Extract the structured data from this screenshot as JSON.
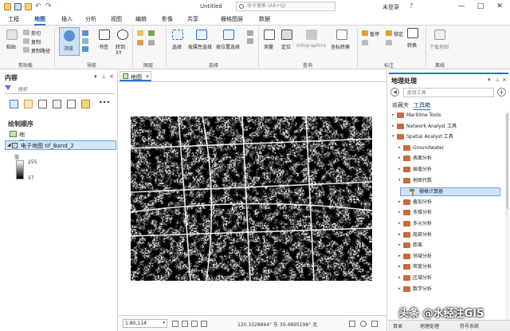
{
  "titlebar": {
    "title": "Untitled",
    "search_placeholder": "命令搜索 (Alt+Q)",
    "login": "未登录",
    "help": "?",
    "minimize": "—",
    "maximize": "□",
    "close": "✕"
  },
  "ribbon_tabs": [
    "工程",
    "地图",
    "插入",
    "分析",
    "视图",
    "编辑",
    "影像",
    "共享",
    "栅格图层",
    "数据"
  ],
  "ribbon_active_tab": "地图",
  "ribbon": {
    "clipboard": {
      "paste": "粘贴",
      "cut": "剪切",
      "copy": "复制",
      "copy_path": "复制路径",
      "group": "剪贴板"
    },
    "navigate": {
      "explore": "浏览",
      "bookmarks": "书签",
      "goto": "转到 XY",
      "group": "导航"
    },
    "layer": {
      "group": "图层"
    },
    "selection": {
      "select": "选择",
      "by_attr": "按属性选择",
      "by_loc": "按位置选择",
      "group": "选择"
    },
    "inquiry": {
      "measure": "测量",
      "locate": "定位",
      "infographics": "Infographics",
      "coord_convert": "坐标转换",
      "group": "查询"
    },
    "labeling": {
      "pause": "暂停",
      "lock": "锁定",
      "convert": "转换",
      "group": "标注"
    },
    "offline": {
      "download_map": "下载地图",
      "group": "离线"
    }
  },
  "contents": {
    "title": "内容",
    "search_placeholder": "搜索",
    "section": "绘制顺序",
    "map_name": "地图",
    "layer_name": "电子地图 tif_Band_2",
    "layer_checked": "✓",
    "value_label": "值",
    "ramp_high": "255",
    "ramp_low": "57"
  },
  "map_view": {
    "tab_label": "地图",
    "scale": "1:80,114",
    "coordinates": "120.3328864° 东 30.4895198° 北"
  },
  "geoprocessing": {
    "title": "地理处理",
    "search_placeholder": "查找工具",
    "tab_favorites": "收藏夹",
    "tab_toolboxes": "工具箱",
    "tree": [
      {
        "label": "Maritime Tools",
        "level": 0,
        "arrow": "▸",
        "type": "toolbox"
      },
      {
        "label": "Network Analyst 工具",
        "level": 0,
        "arrow": "▸",
        "type": "toolbox"
      },
      {
        "label": "Spatial Analyst 工具",
        "level": 0,
        "arrow": "▾",
        "type": "toolbox"
      },
      {
        "label": "Groundwater",
        "level": 1,
        "arrow": "▸",
        "type": "toolset"
      },
      {
        "label": "表面分析",
        "level": 1,
        "arrow": "▸",
        "type": "toolset"
      },
      {
        "label": "插值分析",
        "level": 1,
        "arrow": "▸",
        "type": "toolset"
      },
      {
        "label": "地图代数",
        "level": 1,
        "arrow": "▾",
        "type": "toolset"
      },
      {
        "label": "栅格计算器",
        "level": 2,
        "arrow": "",
        "type": "tool",
        "selected": true
      },
      {
        "label": "叠加分析",
        "level": 1,
        "arrow": "▸",
        "type": "toolset"
      },
      {
        "label": "多维分析",
        "level": 1,
        "arrow": "▸",
        "type": "toolset"
      },
      {
        "label": "多元分析",
        "level": 1,
        "arrow": "▸",
        "type": "toolset"
      },
      {
        "label": "局部分析",
        "level": 1,
        "arrow": "▸",
        "type": "toolset"
      },
      {
        "label": "距离",
        "level": 1,
        "arrow": "▸",
        "type": "toolset"
      },
      {
        "label": "邻域分析",
        "level": 1,
        "arrow": "▸",
        "type": "toolset"
      },
      {
        "label": "密度分析",
        "level": 1,
        "arrow": "▸",
        "type": "toolset"
      },
      {
        "label": "区域分析",
        "level": 1,
        "arrow": "▸",
        "type": "toolset"
      },
      {
        "label": "数学分析",
        "level": 1,
        "arrow": "▸",
        "type": "toolset"
      }
    ]
  },
  "watermark": "头条 @水经注GIS",
  "bottom_tabs": [
    "目录",
    "地理处理",
    "符号系统"
  ],
  "colors": {
    "accent": "#2e6fd0",
    "toolbox": "#c86a3a",
    "selection": "#cfe3f7"
  }
}
